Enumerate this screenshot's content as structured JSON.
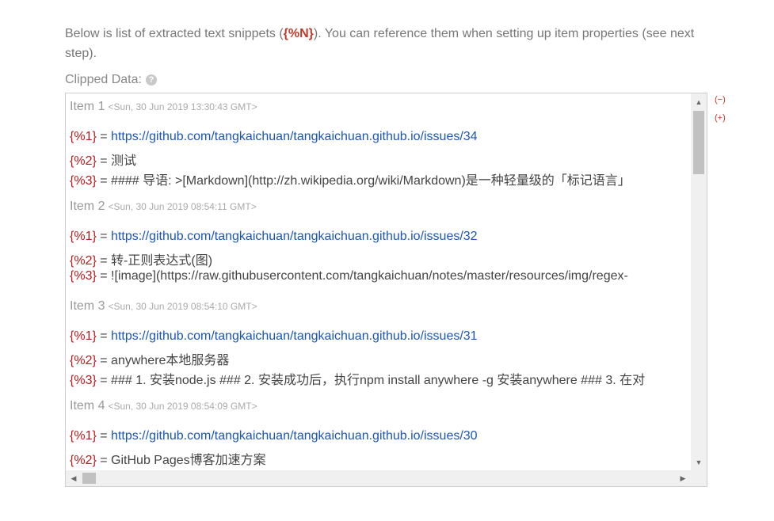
{
  "intro": {
    "before": "Below is list of extracted text snippets (",
    "token": "{%N}",
    "after": "). You can reference them when setting up item properties (see next step)."
  },
  "clipped_label": "Clipped Data:",
  "help_symbol": "?",
  "controls": {
    "collapse": "(−)",
    "expand": "(+)"
  },
  "items": [
    {
      "title": "Item 1",
      "timestamp": "<Sun, 30 Jun 2019 13:30:43 GMT>",
      "fields": [
        {
          "key": "{%1}",
          "eq": " = ",
          "value": "https://github.com/tangkaichuan/tangkaichuan.github.io/issues/34",
          "is_url": true
        },
        {
          "key": "{%2}",
          "eq": " = ",
          "value": "测试",
          "is_url": false
        },
        {
          "key": "{%3}",
          "eq": " = ",
          "value": "#### 导语: >[Markdown](http://zh.wikipedia.org/wiki/Markdown)是一种轻量级的「标记语言」",
          "is_url": false
        }
      ]
    },
    {
      "title": "Item 2",
      "timestamp": "<Sun, 30 Jun 2019 08:54:11 GMT>",
      "fields": [
        {
          "key": "{%1}",
          "eq": " = ",
          "value": "https://github.com/tangkaichuan/tangkaichuan.github.io/issues/32",
          "is_url": true
        },
        {
          "key": "{%2}",
          "eq": " = ",
          "value": "转-正则表达式(图)",
          "is_url": false
        },
        {
          "key": "{%3}",
          "eq": " = ",
          "value": "![image](https://raw.githubusercontent.com/tangkaichuan/notes/master/resources/img/regex-",
          "is_url": false
        }
      ]
    },
    {
      "title": "Item 3",
      "timestamp": "<Sun, 30 Jun 2019 08:54:10 GMT>",
      "fields": [
        {
          "key": "{%1}",
          "eq": " = ",
          "value": "https://github.com/tangkaichuan/tangkaichuan.github.io/issues/31",
          "is_url": true
        },
        {
          "key": "{%2}",
          "eq": " = ",
          "value": "anywhere本地服务器",
          "is_url": false
        },
        {
          "key": "{%3}",
          "eq": " = ",
          "value": "### 1. 安装node.js ### 2. 安装成功后，执行npm install anywhere -g 安装anywhere ### 3. 在对",
          "is_url": false
        }
      ]
    },
    {
      "title": "Item 4",
      "timestamp": "<Sun, 30 Jun 2019 08:54:09 GMT>",
      "fields": [
        {
          "key": "{%1}",
          "eq": " = ",
          "value": "https://github.com/tangkaichuan/tangkaichuan.github.io/issues/30",
          "is_url": true
        },
        {
          "key": "{%2}",
          "eq": " = ",
          "value": "GitHub Pages博客加速方案",
          "is_url": false
        }
      ]
    }
  ],
  "icons": {
    "help": "question-mark-circle-icon",
    "scroll_up": "triangle-up-icon",
    "scroll_down": "triangle-down-icon",
    "scroll_left": "triangle-left-icon",
    "scroll_right": "triangle-right-icon"
  },
  "colors": {
    "key": "#b71c1c",
    "url": "#1a56b8",
    "token": "#c0392b"
  }
}
